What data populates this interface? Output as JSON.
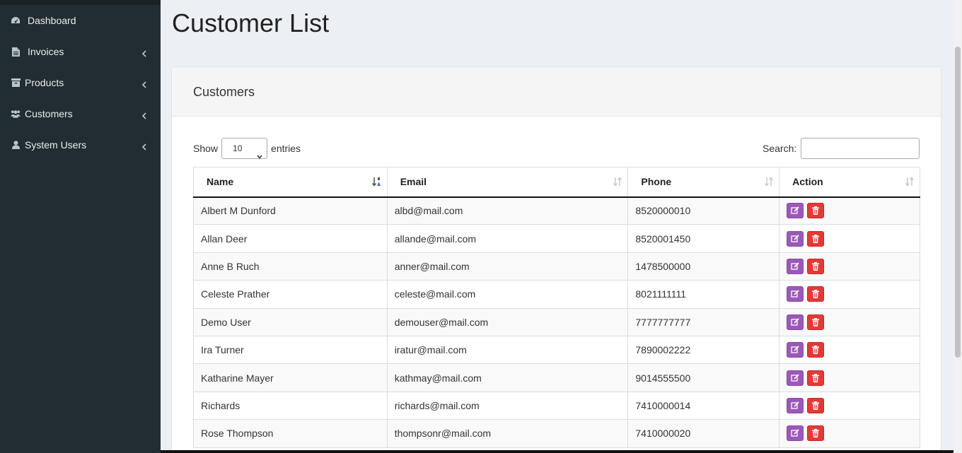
{
  "sidebar": {
    "items": [
      {
        "label": "Dashboard",
        "icon": "dashboard-icon",
        "has_submenu": false
      },
      {
        "label": "Invoices",
        "icon": "file-icon",
        "has_submenu": true
      },
      {
        "label": "Products",
        "icon": "archive-icon",
        "has_submenu": true
      },
      {
        "label": "Customers",
        "icon": "users-icon",
        "has_submenu": true
      },
      {
        "label": "System Users",
        "icon": "user-icon",
        "has_submenu": true
      }
    ]
  },
  "page": {
    "title": "Customer List"
  },
  "box": {
    "title": "Customers"
  },
  "controls": {
    "show_label": "Show",
    "entries_value": "10",
    "entries_label": "entries",
    "search_label": "Search:",
    "search_value": ""
  },
  "table": {
    "columns": [
      "Name",
      "Email",
      "Phone",
      "Action"
    ],
    "rows": [
      {
        "name": "Albert M Dunford",
        "email": "albd@mail.com",
        "phone": "8520000010"
      },
      {
        "name": "Allan Deer",
        "email": "allande@mail.com",
        "phone": "8520001450"
      },
      {
        "name": "Anne B Ruch",
        "email": "anner@mail.com",
        "phone": "1478500000"
      },
      {
        "name": "Celeste Prather",
        "email": "celeste@mail.com",
        "phone": "8021111111"
      },
      {
        "name": "Demo User",
        "email": "demouser@mail.com",
        "phone": "7777777777"
      },
      {
        "name": "Ira Turner",
        "email": "iratur@mail.com",
        "phone": "7890002222"
      },
      {
        "name": "Katharine Mayer",
        "email": "kathmay@mail.com",
        "phone": "9014555500"
      },
      {
        "name": "Richards",
        "email": "richards@mail.com",
        "phone": "7410000014"
      },
      {
        "name": "Rose Thompson",
        "email": "thompsonr@mail.com",
        "phone": "7410000020"
      }
    ]
  },
  "colors": {
    "sidebar_bg": "#222d32",
    "edit_button": "#9b59b6",
    "delete_button": "#e53935",
    "page_bg": "#ecf0f5"
  }
}
